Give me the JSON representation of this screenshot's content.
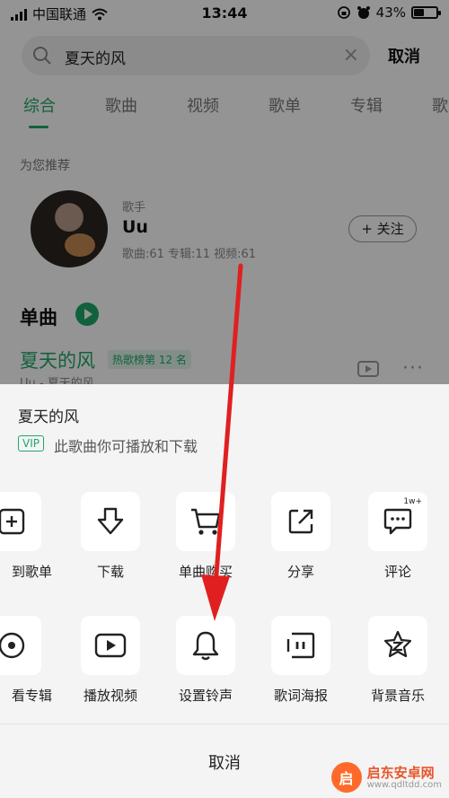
{
  "status_bar": {
    "carrier": "中国联通",
    "time": "13:44",
    "battery": "43%",
    "battery_level": 0.43
  },
  "search": {
    "query": "夏天的风",
    "clear_symbol": "×",
    "cancel_label": "取消"
  },
  "tabs": [
    "综合",
    "歌曲",
    "视频",
    "歌单",
    "专辑",
    "歌"
  ],
  "recommend": {
    "label": "为您推荐",
    "artist_role": "歌手",
    "artist_name": "Uu",
    "artist_stats": "歌曲:61 专辑:11 视频:61",
    "follow_label": "+ 关注"
  },
  "singles": {
    "title": "单曲",
    "song_title": "夏天的风",
    "hot_badge": "热歌榜第 12 名",
    "song_sub": "Uu - 夏天的风"
  },
  "sheet": {
    "song_title": "夏天的风",
    "vip_tag": "VIP",
    "vip_text": "此歌曲你可播放和下载",
    "row1": [
      {
        "label": "到歌单",
        "icon": "add-square-icon"
      },
      {
        "label": "下载",
        "icon": "download-icon"
      },
      {
        "label": "单曲购买",
        "icon": "cart-icon"
      },
      {
        "label": "分享",
        "icon": "share-icon"
      },
      {
        "label": "评论",
        "icon": "comment-icon",
        "badge": "1w+"
      }
    ],
    "row2": [
      {
        "label": "看专辑",
        "icon": "album-icon"
      },
      {
        "label": "播放视频",
        "icon": "play-video-icon"
      },
      {
        "label": "设置铃声",
        "icon": "bell-icon"
      },
      {
        "label": "歌词海报",
        "icon": "lyrics-poster-icon"
      },
      {
        "label": "背景音乐",
        "icon": "background-music-icon"
      }
    ],
    "cancel_label": "取消"
  },
  "watermark": {
    "logo_char": "启",
    "name": "启东安卓网",
    "url": "www.qdltdd.com"
  },
  "colors": {
    "accent": "#1fa86a",
    "arrow": "#e02020",
    "watermark": "#e8562a"
  }
}
